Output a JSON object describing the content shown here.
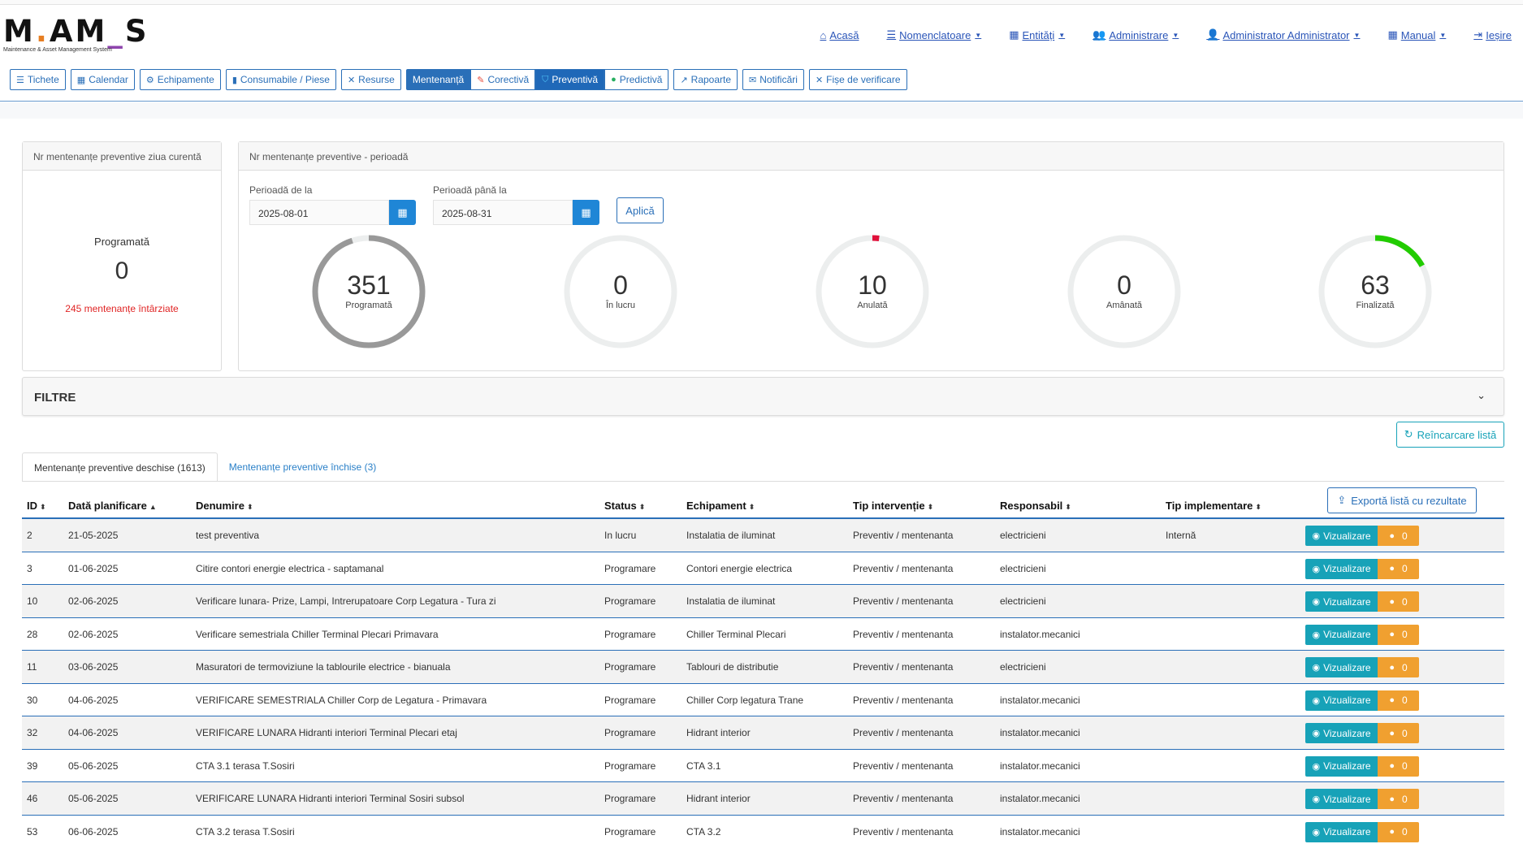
{
  "logo": {
    "text_a": "M",
    "text_dot": ".",
    "text_b": "A",
    "text_c": "M",
    "text_bar": "_",
    "text_d": "S",
    "subtitle": "Maintenance & Asset Management System"
  },
  "topnav": [
    {
      "label": "Acasă",
      "icon": "home-icon",
      "dropdown": false
    },
    {
      "label": "Nomenclatoare",
      "icon": "list-icon",
      "dropdown": true
    },
    {
      "label": "Entități",
      "icon": "table-icon",
      "dropdown": true
    },
    {
      "label": "Administrare",
      "icon": "users-cog-icon",
      "dropdown": true
    },
    {
      "label": "Administrator Administrator",
      "icon": "user-icon",
      "dropdown": true
    },
    {
      "label": "Manual",
      "icon": "book-icon",
      "dropdown": true
    },
    {
      "label": "Ieșire",
      "icon": "sign-out-icon",
      "dropdown": false
    }
  ],
  "toolbar": {
    "tichete": "Tichete",
    "calendar": "Calendar",
    "echipamente": "Echipamente",
    "consumabile": "Consumabile / Piese",
    "resurse": "Resurse",
    "mentenanta": "Mentenanță",
    "corectiva": "Corectivă",
    "preventiva": "Preventivă",
    "predictiva": "Predictivă",
    "rapoarte": "Rapoarte",
    "notificari": "Notificări",
    "fise": "Fișe de verificare"
  },
  "card_today": {
    "header": "Nr mentenanțe preventive ziua curentă",
    "label": "Programată",
    "value": "0",
    "late": "245 mentenanțe întârziate"
  },
  "card_period": {
    "header": "Nr mentenanțe preventive - perioadă",
    "from_label": "Perioadă de la",
    "from_value": "2025-08-01",
    "to_label": "Perioadă până la",
    "to_value": "2025-08-31",
    "apply": "Aplică",
    "rings": [
      {
        "value": "351",
        "label": "Programată",
        "fraction": 0.95,
        "color": "#999999"
      },
      {
        "value": "0",
        "label": "În lucru",
        "fraction": 0,
        "color": "#999999"
      },
      {
        "value": "10",
        "label": "Anulată",
        "fraction": 0.02,
        "color": "#e0103a"
      },
      {
        "value": "0",
        "label": "Amânată",
        "fraction": 0,
        "color": "#999999"
      },
      {
        "value": "63",
        "label": "Finalizată",
        "fraction": 0.17,
        "color": "#22cc00"
      }
    ]
  },
  "filters": {
    "title": "FILTRE"
  },
  "reload": "Reîncarcare listă",
  "export": "Exportă listă cu rezultate",
  "tabs": [
    {
      "label": "Mentenanțe preventive deschise (1613)",
      "active": true
    },
    {
      "label": "Mentenanțe preventive închise (3)",
      "active": false
    }
  ],
  "table": {
    "headers": {
      "id": "ID",
      "date": "Dată planificare",
      "name": "Denumire",
      "status": "Status",
      "equip": "Echipament",
      "type": "Tip intervenție",
      "resp": "Responsabil",
      "impl": "Tip implementare"
    },
    "view_label": "Vizualizare",
    "rows": [
      {
        "id": "2",
        "date": "21-05-2025",
        "name": "test preventiva",
        "status": "In lucru",
        "equip": "Instalatia de iluminat",
        "type": "Preventiv / mentenanta",
        "resp": "electricieni",
        "impl": "Internă",
        "comments": "0"
      },
      {
        "id": "3",
        "date": "01-06-2025",
        "name": "Citire contori energie electrica - saptamanal",
        "status": "Programare",
        "equip": "Contori energie electrica",
        "type": "Preventiv / mentenanta",
        "resp": "electricieni",
        "impl": "",
        "comments": "0"
      },
      {
        "id": "10",
        "date": "02-06-2025",
        "name": "Verificare lunara- Prize, Lampi, Intrerupatoare Corp Legatura - Tura zi",
        "status": "Programare",
        "equip": "Instalatia de iluminat",
        "type": "Preventiv / mentenanta",
        "resp": "electricieni",
        "impl": "",
        "comments": "0"
      },
      {
        "id": "28",
        "date": "02-06-2025",
        "name": "Verificare semestriala Chiller Terminal Plecari Primavara",
        "status": "Programare",
        "equip": "Chiller Terminal Plecari",
        "type": "Preventiv / mentenanta",
        "resp": "instalator.mecanici",
        "impl": "",
        "comments": "0"
      },
      {
        "id": "11",
        "date": "03-06-2025",
        "name": "Masuratori de termoviziune la tablourile electrice - bianuala",
        "status": "Programare",
        "equip": "Tablouri de distributie",
        "type": "Preventiv / mentenanta",
        "resp": "electricieni",
        "impl": "",
        "comments": "0"
      },
      {
        "id": "30",
        "date": "04-06-2025",
        "name": "VERIFICARE SEMESTRIALA Chiller Corp de Legatura - Primavara",
        "status": "Programare",
        "equip": "Chiller Corp legatura Trane",
        "type": "Preventiv / mentenanta",
        "resp": "instalator.mecanici",
        "impl": "",
        "comments": "0"
      },
      {
        "id": "32",
        "date": "04-06-2025",
        "name": "VERIFICARE LUNARA Hidranti interiori Terminal Plecari etaj",
        "status": "Programare",
        "equip": "Hidrant interior",
        "type": "Preventiv / mentenanta",
        "resp": "instalator.mecanici",
        "impl": "",
        "comments": "0"
      },
      {
        "id": "39",
        "date": "05-06-2025",
        "name": "CTA 3.1 terasa T.Sosiri",
        "status": "Programare",
        "equip": "CTA 3.1",
        "type": "Preventiv / mentenanta",
        "resp": "instalator.mecanici",
        "impl": "",
        "comments": "0"
      },
      {
        "id": "46",
        "date": "05-06-2025",
        "name": "VERIFICARE LUNARA Hidranti interiori Terminal Sosiri subsol",
        "status": "Programare",
        "equip": "Hidrant interior",
        "type": "Preventiv / mentenanta",
        "resp": "instalator.mecanici",
        "impl": "",
        "comments": "0"
      },
      {
        "id": "53",
        "date": "06-06-2025",
        "name": "CTA 3.2 terasa T.Sosiri",
        "status": "Programare",
        "equip": "CTA 3.2",
        "type": "Preventiv / mentenanta",
        "resp": "instalator.mecanici",
        "impl": "",
        "comments": "0"
      }
    ]
  }
}
